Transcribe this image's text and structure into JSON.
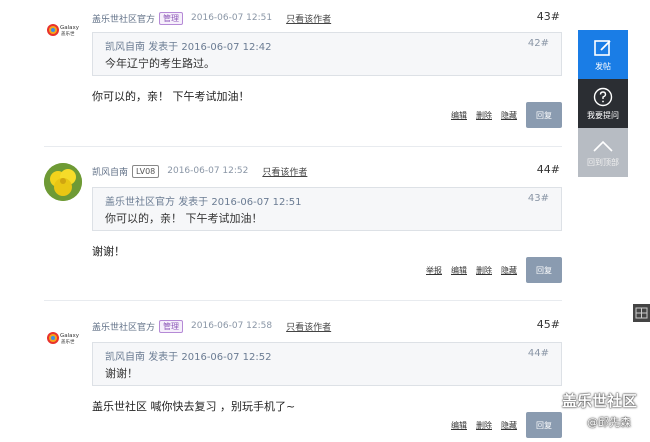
{
  "posts": [
    {
      "avatar": "galaxy-logo",
      "author": "盖乐世社区官方",
      "badge": "管理",
      "time": "2016-06-07 12:51",
      "only_author": "只看该作者",
      "floor": "43#",
      "quote": {
        "author": "凯风自南",
        "posted": "发表于",
        "time": "2016-06-07 12:42",
        "floor": "42#",
        "text": "今年辽宁的考生路过。"
      },
      "content": "你可以的，亲！ 下午考试加油！",
      "actions": [
        "编辑",
        "删除",
        "隐藏"
      ],
      "reply": "回复"
    },
    {
      "avatar": "yellow-flower",
      "author": "凯风自南",
      "badge": "LV08",
      "time": "2016-06-07 12:52",
      "only_author": "只看该作者",
      "floor": "44#",
      "quote": {
        "author": "盖乐世社区官方",
        "posted": "发表于",
        "time": "2016-06-07 12:51",
        "floor": "43#",
        "text": "你可以的，亲！ 下午考试加油！"
      },
      "content": "谢谢！",
      "actions": [
        "举报",
        "编辑",
        "删除",
        "隐藏"
      ],
      "reply": "回复"
    },
    {
      "avatar": "galaxy-logo",
      "author": "盖乐世社区官方",
      "badge": "管理",
      "time": "2016-06-07 12:58",
      "only_author": "只看该作者",
      "floor": "45#",
      "quote": {
        "author": "凯风自南",
        "posted": "发表于",
        "time": "2016-06-07 12:52",
        "floor": "44#",
        "text": "谢谢！"
      },
      "content": "盖乐世社区 喊你快去复习 ，别玩手机了~",
      "actions": [
        "编辑",
        "删除",
        "隐藏"
      ],
      "reply": "回复"
    }
  ],
  "sidebar": {
    "post": "发帖",
    "ask": "我要提问",
    "top": "回到顶部"
  },
  "watermark": {
    "line1": "盖乐世社区",
    "line2": "@邱先森"
  },
  "colors": {
    "accent": "#1a7de6",
    "reply_button": "#8a9bb0",
    "admin_badge": "#8e5ab8"
  }
}
